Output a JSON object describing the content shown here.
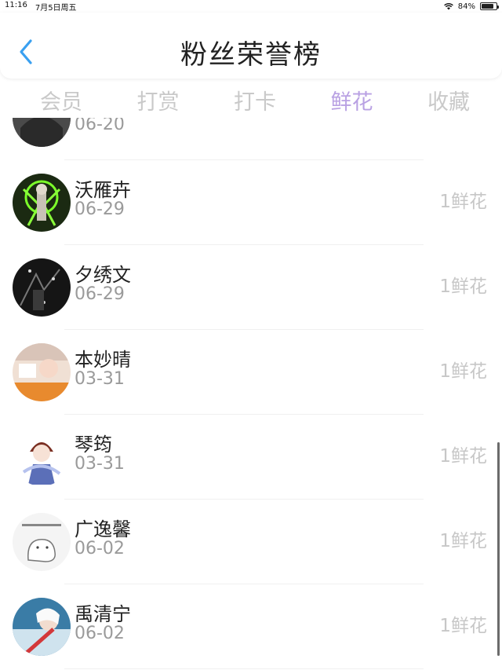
{
  "status_bar": {
    "time": "11:16",
    "date": "7月5日周五",
    "battery": "84%",
    "battery_level": 0.84
  },
  "header": {
    "title": "粉丝荣誉榜",
    "accent_color": "#3aa0f0"
  },
  "tabs": [
    {
      "label": "会员",
      "active": false
    },
    {
      "label": "打赏",
      "active": false
    },
    {
      "label": "打卡",
      "active": false
    },
    {
      "label": "鲜花",
      "active": true
    },
    {
      "label": "收藏",
      "active": false
    }
  ],
  "list": {
    "items": [
      {
        "name": "",
        "date": "06-20",
        "count": "",
        "avatar": "gray-photo"
      },
      {
        "name": "沃雁卉",
        "date": "06-29",
        "count": "1鲜花",
        "avatar": "green-glow-figure"
      },
      {
        "name": "夕绣文",
        "date": "06-29",
        "count": "1鲜花",
        "avatar": "dark-photo"
      },
      {
        "name": "本妙晴",
        "date": "03-31",
        "count": "1鲜花",
        "avatar": "orange-photo"
      },
      {
        "name": "琴筠",
        "date": "03-31",
        "count": "1鲜花",
        "avatar": "anime-boy"
      },
      {
        "name": "广逸馨",
        "date": "06-02",
        "count": "1鲜花",
        "avatar": "cartoon-sketch"
      },
      {
        "name": "禹清宁",
        "date": "06-02",
        "count": "1鲜花",
        "avatar": "winter-girl"
      }
    ]
  },
  "colors": {
    "tab_active": "#b9a1e3",
    "tab_inactive": "#c9c9c9",
    "date": "#9a9a9a",
    "count": "#c7c7c7"
  }
}
